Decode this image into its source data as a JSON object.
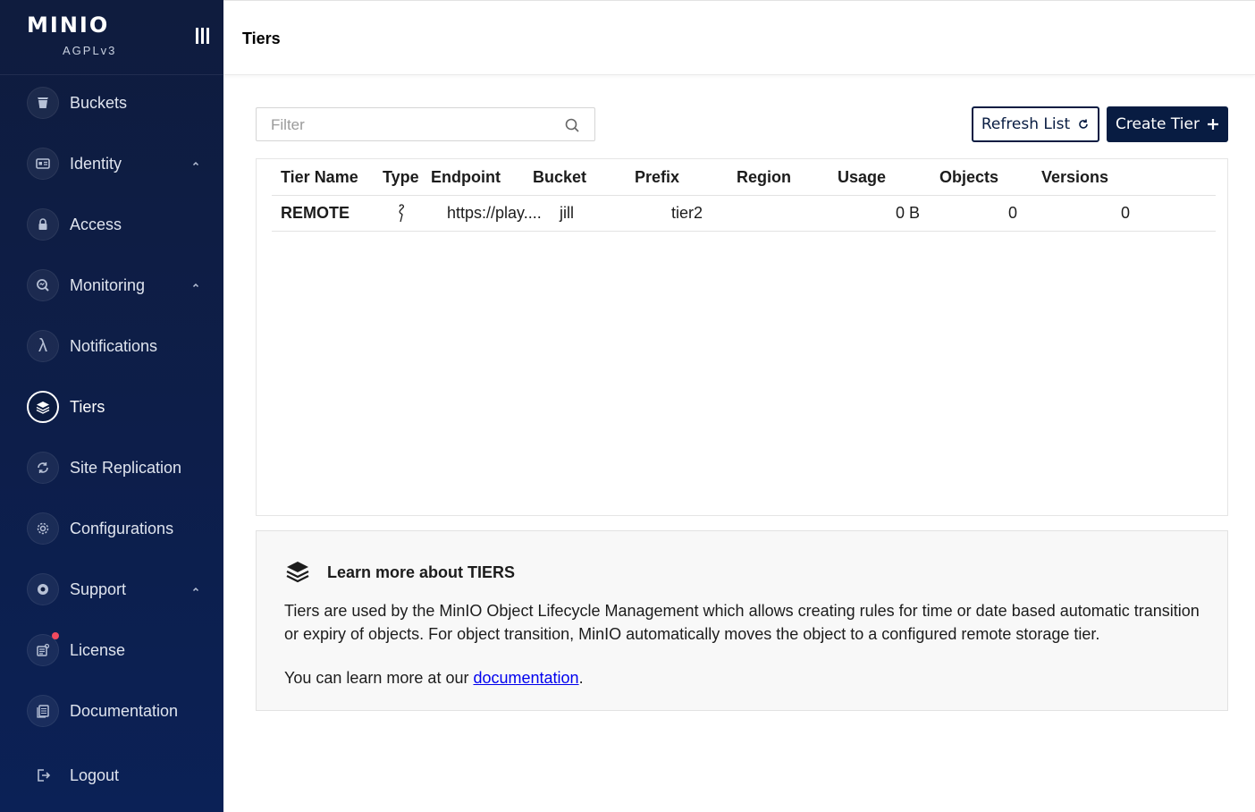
{
  "sidebar": {
    "logo": "MINIO",
    "license": "AGPLv3",
    "items": [
      {
        "label": "Buckets"
      },
      {
        "label": "Identity"
      },
      {
        "label": "Access"
      },
      {
        "label": "Monitoring"
      },
      {
        "label": "Notifications"
      },
      {
        "label": "Tiers"
      },
      {
        "label": "Site Replication"
      },
      {
        "label": "Configurations"
      },
      {
        "label": "Support"
      },
      {
        "label": "License"
      },
      {
        "label": "Documentation"
      },
      {
        "label": "Logout"
      }
    ]
  },
  "header": {
    "title": "Tiers"
  },
  "filter": {
    "placeholder": "Filter"
  },
  "buttons": {
    "refresh": "Refresh List",
    "create": "Create Tier"
  },
  "table": {
    "columns": [
      "Tier Name",
      "Type",
      "Endpoint",
      "Bucket",
      "Prefix",
      "Region",
      "Usage",
      "Objects",
      "Versions"
    ],
    "rows": [
      {
        "name": "REMOTE",
        "type_icon": "minio-bird-icon",
        "endpoint": "https://play....",
        "bucket": "jill",
        "prefix": "tier2",
        "region": "",
        "usage": "0 B",
        "objects": "0",
        "versions": "0"
      }
    ]
  },
  "info": {
    "title": "Learn more about TIERS",
    "text": "Tiers are used by the MinIO Object Lifecycle Management which allows creating rules for time or date based automatic transition or expiry of objects. For object transition, MinIO automatically moves the object to a configured remote storage tier.",
    "more_prefix": "You can learn more at our ",
    "link": "documentation",
    "more_suffix": "."
  },
  "colors": {
    "sidebar": "#0f1c3e",
    "primary": "#081c42",
    "active_border": "#ffffff",
    "notification_dot": "#f04a5f"
  }
}
